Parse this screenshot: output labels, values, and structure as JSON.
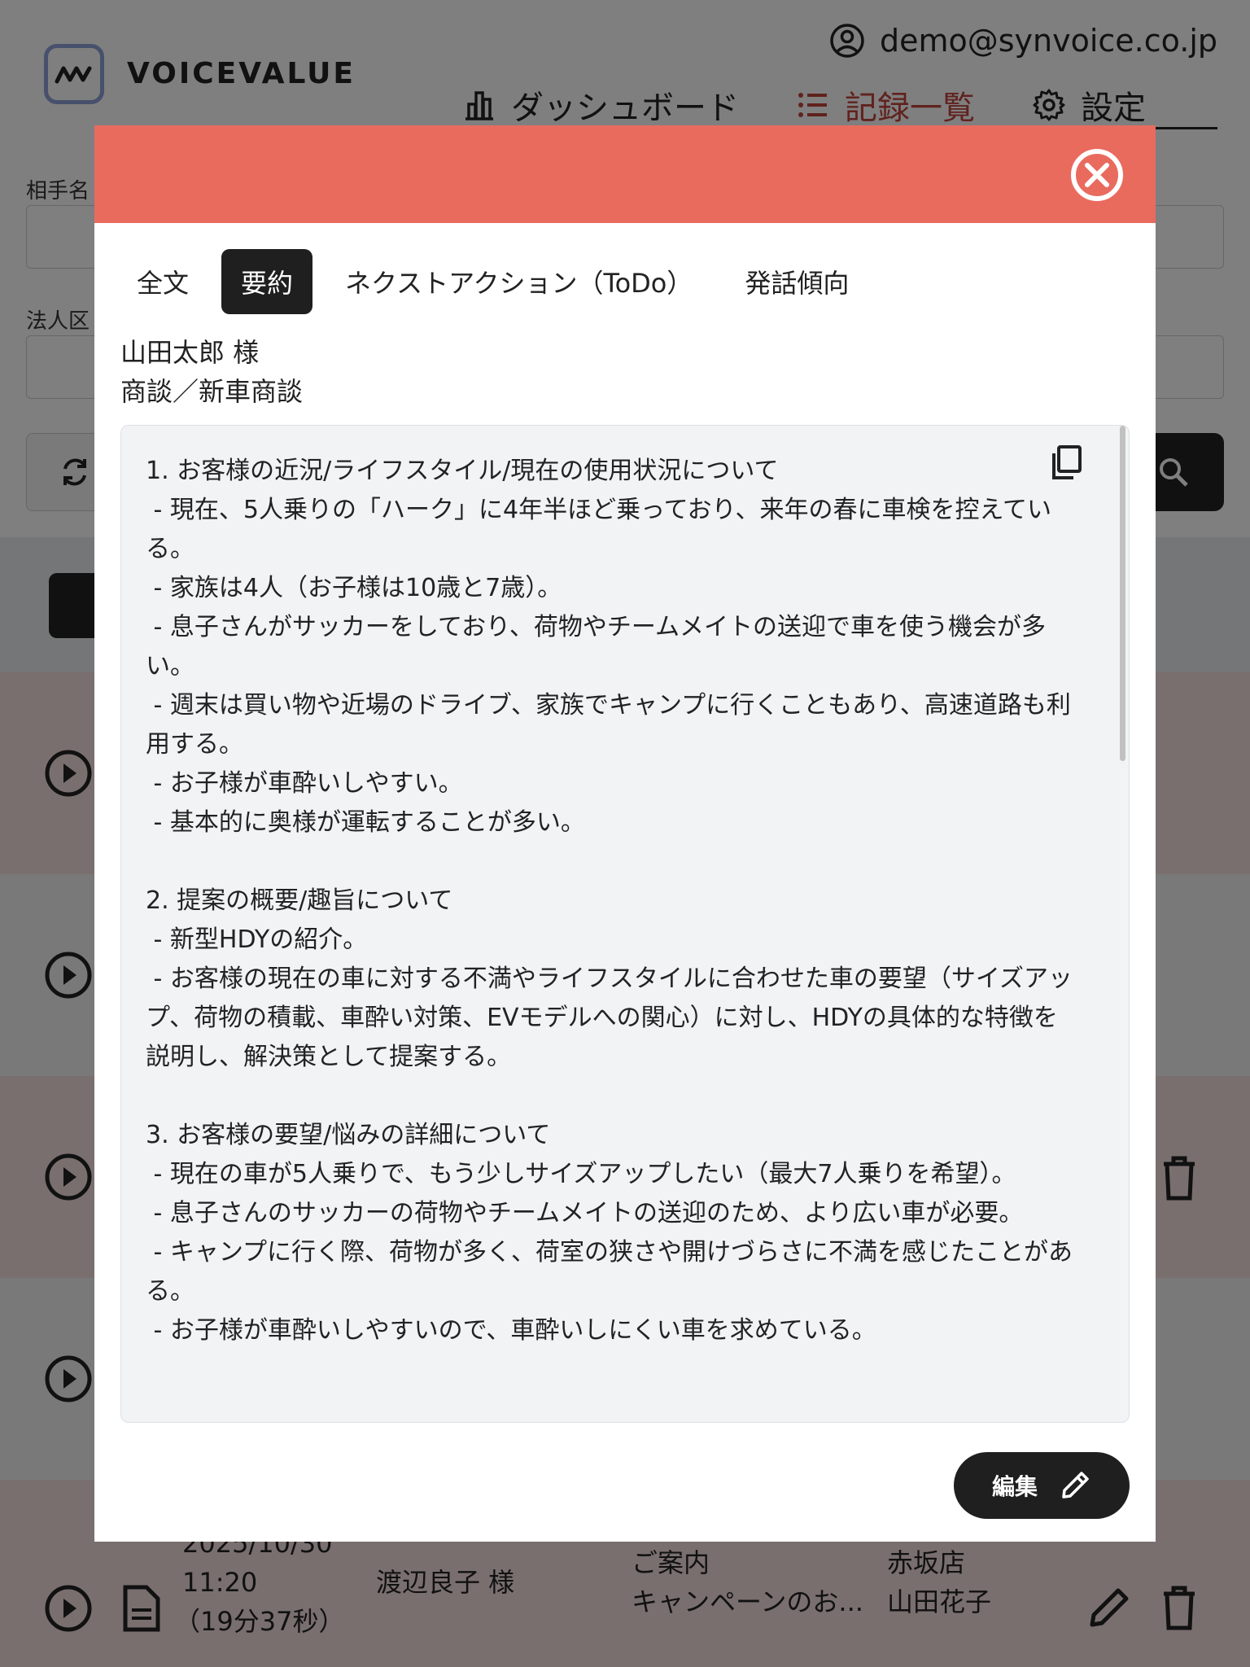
{
  "header": {
    "brand": "VOICEVALUE",
    "user_email": "demo@synvoice.co.jp",
    "nav": [
      {
        "label": "ダッシュボード",
        "icon": "chart-bar-icon"
      },
      {
        "label": "記録一覧",
        "icon": "list-icon",
        "active": true
      },
      {
        "label": "設定",
        "icon": "gear-icon"
      }
    ]
  },
  "filters": {
    "partner_label": "相手名",
    "corp_label": "法人区"
  },
  "rows": [
    {
      "date": "2025/10/30",
      "time": "11:20",
      "duration": "（19分37秒）",
      "customer": "渡辺良子 様",
      "purpose": "ご案内",
      "subject": "キャンペーンのお...",
      "store": "赤坂店",
      "staff": "山田花子"
    }
  ],
  "modal": {
    "tabs": [
      {
        "label": "全文"
      },
      {
        "label": "要約",
        "active": true
      },
      {
        "label": "ネクストアクション（ToDo）"
      },
      {
        "label": "発話傾向"
      }
    ],
    "customer_name": "山田太郎 様",
    "meeting_type": "商談／新車商談",
    "summary": "1. お客様の近況/ライフスタイル/現在の使用状況について\n - 現在、5人乗りの「ハーク」に4年半ほど乗っており、来年の春に車検を控えている。\n - 家族は4人（お子様は10歳と7歳）。\n - 息子さんがサッカーをしており、荷物やチームメイトの送迎で車を使う機会が多い。\n - 週末は買い物や近場のドライブ、家族でキャンプに行くこともあり、高速道路も利用する。\n - お子様が車酔いしやすい。\n - 基本的に奥様が運転することが多い。\n\n2. 提案の概要/趣旨について\n - 新型HDYの紹介。\n - お客様の現在の車に対する不満やライフスタイルに合わせた車の要望（サイズアップ、荷物の積載、車酔い対策、EVモデルへの関心）に対し、HDYの具体的な特徴を説明し、解決策として提案する。\n\n3. お客様の要望/悩みの詳細について\n - 現在の車が5人乗りで、もう少しサイズアップしたい（最大7人乗りを希望）。\n - 息子さんのサッカーの荷物やチームメイトの送迎のため、より広い車が必要。\n - キャンプに行く際、荷物が多く、荷室の狭さや開けづらさに不満を感じたことがある。\n - お子様が車酔いしやすいので、車酔いしにくい車を求めている。",
    "edit_label": "編集"
  },
  "colors": {
    "modal_header": "#e96b5e",
    "active_nav": "#c0453c",
    "dark": "#1f1f1f"
  }
}
